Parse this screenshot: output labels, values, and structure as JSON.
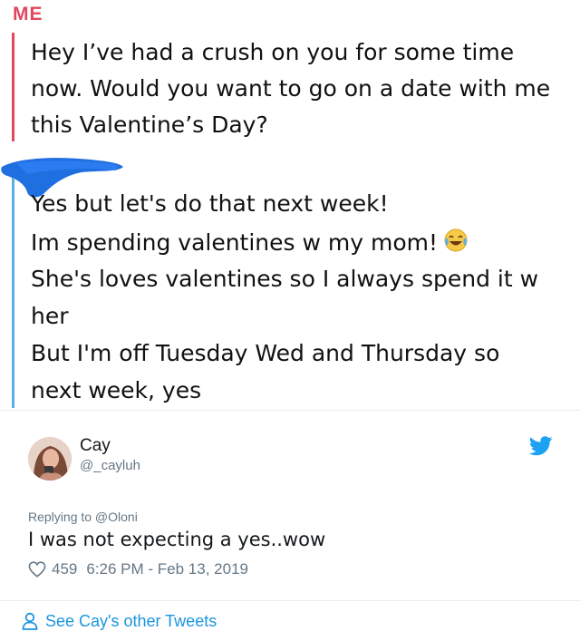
{
  "chat": {
    "sender_label": "ME",
    "my_message": "Hey I’ve had a crush on you for some time now. Would you want to go on a date with me this Valentine’s Day?",
    "reply_lines": [
      "Yes but let's do that next week!",
      "Im spending valentines w my mom!",
      "She's loves valentines so I always spend it w",
      "her",
      "But I'm off Tuesday Wed and Thursday so",
      "next week, yes"
    ],
    "reply_emoji": "tears-of-joy-emoji",
    "accent_me": "#e2475e",
    "accent_them": "#5ab0e3"
  },
  "tweet": {
    "name": "Cay",
    "handle": "@_cayluh",
    "replying_to": "Replying to @Oloni",
    "text": "I was not expecting a yes..wow",
    "likes": "459",
    "time": "6:26 PM - Feb 13, 2019",
    "see_other": "See Cay's other Tweets",
    "accent": "#1da1f2"
  }
}
